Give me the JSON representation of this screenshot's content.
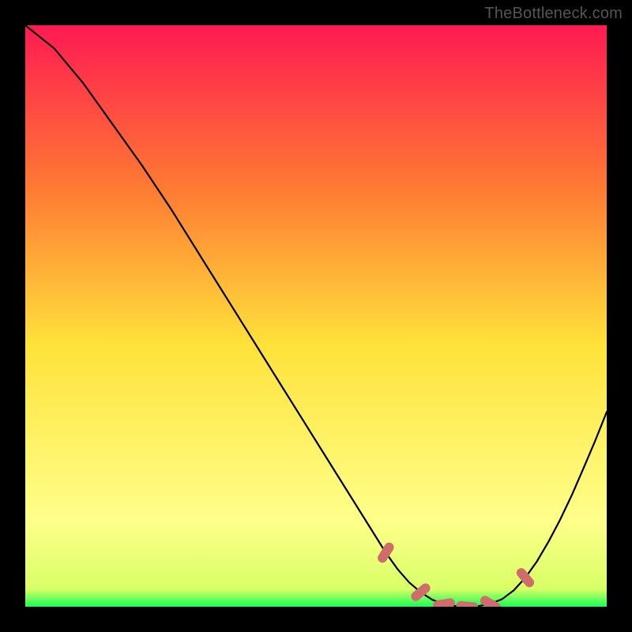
{
  "watermark": "TheBottleneck.com",
  "chart_data": {
    "type": "line",
    "title": "",
    "xlabel": "",
    "ylabel": "",
    "xlim": [
      0,
      100
    ],
    "ylim": [
      0,
      100
    ],
    "grid": false,
    "legend": false,
    "gradient": {
      "top": "#ff1a52",
      "mid1": "#ff7a33",
      "mid2": "#ffe23a",
      "mid3": "#ffff8a",
      "bottom": "#15ff55"
    },
    "series": [
      {
        "name": "curve",
        "x": [
          0,
          5,
          10,
          15,
          20,
          25,
          30,
          35,
          40,
          45,
          50,
          55,
          60,
          62,
          64,
          66,
          68,
          70,
          72,
          74,
          76,
          78,
          80,
          82,
          84,
          86,
          88,
          90,
          92,
          94,
          96,
          98,
          100
        ],
        "y": [
          100,
          96,
          90,
          83,
          76,
          68.5,
          60.5,
          52.5,
          44.5,
          36.5,
          28.5,
          20.5,
          12.5,
          9.3,
          6.5,
          4.2,
          2.5,
          1.2,
          0.45,
          0.12,
          0.05,
          0.12,
          0.5,
          1.3,
          2.8,
          5.0,
          7.8,
          11.2,
          15.0,
          19.2,
          23.8,
          28.5,
          33.5
        ],
        "color": "#000000",
        "stroke_width": 2
      }
    ],
    "markers": {
      "name": "min-cluster",
      "color": "#ce6d6b",
      "shape": "rotated-capsule",
      "points": [
        {
          "x": 62,
          "y": 9.3,
          "rot": -58
        },
        {
          "x": 68,
          "y": 2.5,
          "rot": -40
        },
        {
          "x": 72,
          "y": 0.45,
          "rot": -10
        },
        {
          "x": 76,
          "y": 0.05,
          "rot": 5
        },
        {
          "x": 80,
          "y": 0.5,
          "rot": 30
        },
        {
          "x": 86,
          "y": 5.0,
          "rot": 50
        }
      ]
    }
  }
}
